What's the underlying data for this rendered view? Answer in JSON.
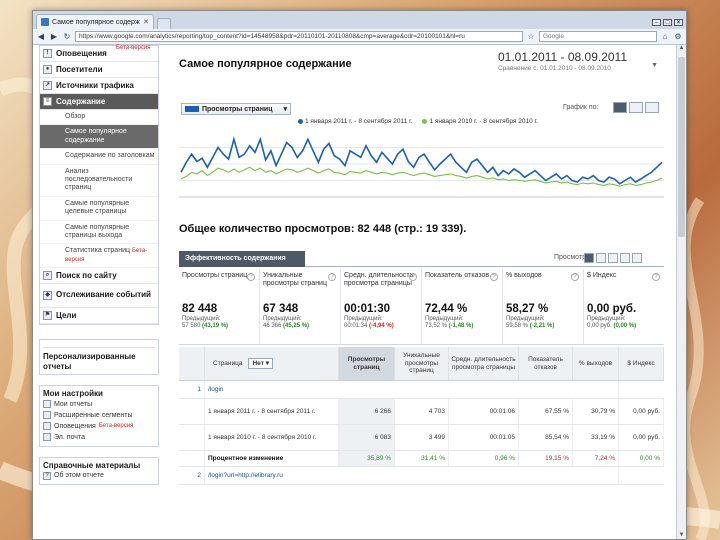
{
  "browser": {
    "tab_title": "Самое популярное содержание - Goo...",
    "url": "https://www.google.com/analytics/reporting/top_content?id=14548958&pdr=20110101-20110808&cmp=average&cdr=20100101&hl=ru",
    "search_placeholder": "Google"
  },
  "sidebar": {
    "beta_top": "Бета-версия",
    "items": [
      {
        "label": "Оповещения",
        "icon": "bell-icon"
      },
      {
        "label": "Посетители",
        "icon": "people-icon"
      },
      {
        "label": "Источники трафика",
        "icon": "traffic-icon"
      },
      {
        "label": "Содержание",
        "icon": "content-icon"
      }
    ],
    "content_sub": [
      "Обзор",
      "Самое популярное содержание",
      "Содержание по заголовкам",
      "Анализ последовательности страниц",
      "Самые популярные целевые страницы",
      "Самые популярные страницы выхода",
      "Статистика страниц"
    ],
    "beta_stats": "Бета-версия",
    "after_items": [
      {
        "label": "Поиск по сайту",
        "icon": "search-icon"
      },
      {
        "label": "Отслеживание событий",
        "icon": "events-icon"
      },
      {
        "label": "Цели",
        "icon": "flag-icon"
      }
    ],
    "personalized": "Персонализированные отчеты",
    "settings_title": "Мои настройки",
    "settings_items": [
      {
        "label": "Мои отчеты",
        "icon": "report-icon"
      },
      {
        "label": "Расширенные сегменты",
        "icon": "segment-icon"
      },
      {
        "label": "Оповещения",
        "icon": "bell-icon",
        "beta": "Бета-версия"
      },
      {
        "label": "Эл. почта",
        "icon": "mail-icon"
      }
    ],
    "help_title": "Справочные материалы",
    "help_item": "Об этом отчете"
  },
  "main": {
    "title": "Самое популярное содержание",
    "date_range": "01.01.2011 - 08.09.2011",
    "compare_label": "Сравнение с: 01.01.2010 - 08.09.2010",
    "metric_selector": "Просмотры страниц",
    "graph_by": "График по:",
    "legend_current": "1 января 2011 г. - 8 сентября 2011 г.",
    "legend_previous": "1 января 2010 г. - 8 сентября 2010 г.",
    "total": "Общее количество просмотров: 82 448 (стр.: 19 339).",
    "tab_label": "Эффективность содержания",
    "views_label": "Просмотры",
    "stats": [
      {
        "label": "Просмотры страниц",
        "value": "82 448",
        "prev_label": "Предыдущий:",
        "prev": "57 580",
        "change": "(43,19 %)",
        "neg": false
      },
      {
        "label": "Уникальные просмотры страниц",
        "value": "67 348",
        "prev_label": "Предыдущий:",
        "prev": "46 366",
        "change": "(45,25 %)",
        "neg": false
      },
      {
        "label": "Средн. длительность просмотра страницы",
        "value": "00:01:30",
        "prev_label": "Предыдущий:",
        "prev": "00:01:34",
        "change": "(-4,94 %)",
        "neg": true
      },
      {
        "label": "Показатель отказов",
        "value": "72,44 %",
        "prev_label": "Предыдущий:",
        "prev": "73,52 %",
        "change": "(-1,48 %)",
        "neg": false
      },
      {
        "label": "% выходов",
        "value": "58,27 %",
        "prev_label": "Предыдущий:",
        "prev": "59,58 %",
        "change": "(-2,21 %)",
        "neg": false
      },
      {
        "label": "$ Индекс",
        "value": "0,00 руб.",
        "prev_label": "Предыдущий:",
        "prev": "0,00 руб.",
        "change": "(0,00 %)",
        "neg": false
      }
    ]
  },
  "table": {
    "headers": [
      "Страница",
      "Просмотры страниц",
      "Уникальные просмотры страниц",
      "Средн. длительность просмотра страницы",
      "Показатель отказов",
      "% выходов",
      "$ Индекс"
    ],
    "select_value": "Нет",
    "rows": [
      {
        "idx": "1",
        "page": "/login",
        "current": {
          "label": "1 января 2011 г. - 8 сентября 2011 г.",
          "values": [
            "6 266",
            "4 703",
            "00:01:06",
            "67,55 %",
            "30,79 %",
            "0,00 руб."
          ]
        },
        "previous": {
          "label": "1 января 2010 г. - 8 сентября 2010 г.",
          "values": [
            "6 083",
            "3 499",
            "00:01:05",
            "85,54 %",
            "33,19 %",
            "0,00 руб."
          ]
        },
        "change": {
          "label": "Процентное изменение",
          "values": [
            "35,89 %",
            "31,41 %",
            "0,96 %",
            "19,15 %",
            "7,24 %",
            "0,00 %"
          ]
        }
      },
      {
        "idx": "2",
        "page": "/login?url=http://elibrary.ru"
      }
    ]
  },
  "chart_data": {
    "type": "line",
    "series": [
      {
        "name": "1 января 2011 г. - 8 сентября 2011 г.",
        "color": "#1b5fb6",
        "values": [
          300,
          420,
          520,
          430,
          470,
          360,
          480,
          600,
          520,
          460,
          700,
          480,
          520,
          620,
          540,
          700,
          450,
          560,
          380,
          520,
          660,
          600,
          480,
          560,
          700,
          560,
          420,
          580,
          650,
          500,
          460,
          380,
          560,
          520,
          480,
          620,
          500,
          420,
          540,
          470,
          400,
          520,
          580,
          430,
          360,
          480,
          520,
          420,
          330,
          400,
          460,
          520,
          420,
          360,
          300,
          420,
          460,
          380,
          300,
          360,
          260,
          320,
          280,
          340,
          300,
          240,
          280,
          320,
          260,
          200,
          240,
          280,
          220,
          260,
          200,
          180,
          240,
          220,
          260,
          200,
          180,
          240,
          220,
          160,
          200,
          240,
          180,
          220,
          260,
          300,
          360,
          420
        ]
      },
      {
        "name": "1 января 2010 г. - 8 сентября 2010 г.",
        "color": "#79c043",
        "values": [
          220,
          250,
          300,
          280,
          320,
          260,
          300,
          350,
          330,
          300,
          340,
          300,
          330,
          360,
          320,
          350,
          300,
          320,
          280,
          310,
          340,
          330,
          300,
          320,
          350,
          320,
          290,
          320,
          340,
          300,
          290,
          270,
          310,
          300,
          290,
          320,
          300,
          280,
          300,
          290,
          270,
          290,
          300,
          280,
          260,
          280,
          290,
          270,
          250,
          260,
          270,
          280,
          260,
          250,
          230,
          250,
          260,
          240,
          220,
          230,
          210,
          220,
          200,
          210,
          200,
          190,
          200,
          210,
          190,
          170,
          180,
          190,
          170,
          180,
          160,
          150,
          170,
          160,
          170,
          150,
          140,
          160,
          150,
          130,
          150,
          160,
          140,
          150,
          170,
          180,
          200,
          230
        ]
      }
    ],
    "ylim": [
      0,
      800
    ]
  }
}
